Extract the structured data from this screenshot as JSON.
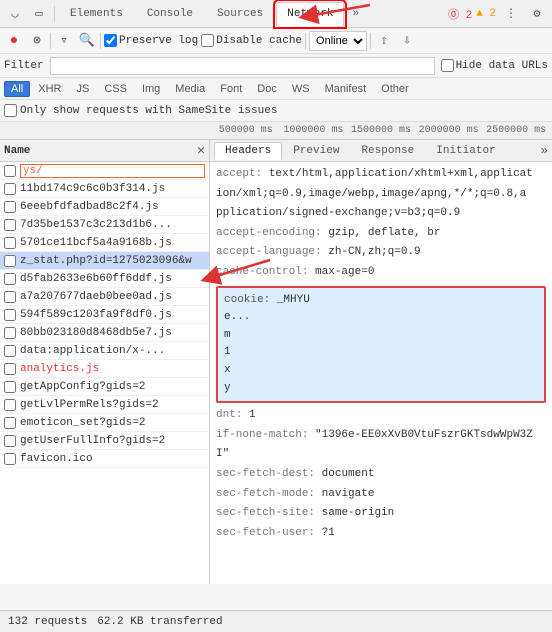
{
  "devtools": {
    "tabs": [
      {
        "label": "Elements",
        "active": false
      },
      {
        "label": "Console",
        "active": false
      },
      {
        "label": "Sources",
        "active": false
      },
      {
        "label": "Network",
        "active": true
      },
      {
        "label": "»",
        "active": false
      }
    ],
    "toolbar_icons": [
      "record",
      "clear",
      "filter",
      "search"
    ],
    "preserve_log": {
      "label": "Preserve log",
      "checked": true
    },
    "disable_cache": {
      "label": "Disable cache",
      "checked": false
    },
    "online_label": "Online",
    "error_badge": "⓪ 2",
    "warning_badge": "▲ 2",
    "more_icon": "⋮",
    "settings_icon": "⚙"
  },
  "filter_bar": {
    "label": "Filter",
    "hide_data_label": "Hide data URLs"
  },
  "type_filters": [
    {
      "label": "All",
      "active": true
    },
    {
      "label": "XHR"
    },
    {
      "label": "JS"
    },
    {
      "label": "CSS"
    },
    {
      "label": "Img"
    },
    {
      "label": "Media"
    },
    {
      "label": "Font"
    },
    {
      "label": "Doc"
    },
    {
      "label": "WS"
    },
    {
      "label": "Manifest"
    },
    {
      "label": "Other"
    }
  ],
  "samesite": {
    "label": "Only show requests with SameSite issues"
  },
  "waterfall": {
    "ticks": [
      "500000 ms",
      "1000000 ms",
      "1500000 ms",
      "2000000 ms",
      "2500000 ms"
    ]
  },
  "left_panel": {
    "column_name": "Name",
    "close_btn": "✕",
    "items": [
      {
        "name": "ys/",
        "selected": false,
        "highlight": true,
        "red": false
      },
      {
        "name": "11bd174c9c6c0b3f314.js",
        "selected": false,
        "highlight": false,
        "red": false
      },
      {
        "name": "6eeebfdfadbad8c2f4.js",
        "selected": false,
        "highlight": false,
        "red": false
      },
      {
        "name": "7d35be1537c3c213d1b6...",
        "selected": false,
        "highlight": false,
        "red": false
      },
      {
        "name": "5701ce11bcf5a4a9168b.js",
        "selected": false,
        "highlight": false,
        "red": false
      },
      {
        "name": "z_stat.php?id=1275023096&w",
        "selected": true,
        "highlight": false,
        "red": false
      },
      {
        "name": "d5fab2633e6b60ff6ddf.js",
        "selected": false,
        "highlight": false,
        "red": false
      },
      {
        "name": "a7a207677daeb0bee0ad.js",
        "selected": false,
        "highlight": false,
        "red": false
      },
      {
        "name": "594f589c1203fa9f8df0.js",
        "selected": false,
        "highlight": false,
        "red": false
      },
      {
        "name": "80bb023180d8468db5e7.js",
        "selected": false,
        "highlight": false,
        "red": false
      },
      {
        "name": "data:application/x-...",
        "selected": false,
        "highlight": false,
        "red": false
      },
      {
        "name": "analytics.js",
        "selected": false,
        "highlight": false,
        "red": true
      },
      {
        "name": "getAppConfig?gids=2",
        "selected": false,
        "highlight": false,
        "red": false
      },
      {
        "name": "getLvlPermRels?gids=2",
        "selected": false,
        "highlight": false,
        "red": false
      },
      {
        "name": "emoticon_set?gids=2",
        "selected": false,
        "highlight": false,
        "red": false
      },
      {
        "name": "getUserFullInfo?gids=2",
        "selected": false,
        "highlight": false,
        "red": false
      },
      {
        "name": "favicon.ico",
        "selected": false,
        "highlight": false,
        "red": false
      }
    ]
  },
  "right_panel": {
    "tabs": [
      {
        "label": "Headers",
        "active": true
      },
      {
        "label": "Preview",
        "active": false
      },
      {
        "label": "Response",
        "active": false
      },
      {
        "label": "Initiator",
        "active": false
      },
      {
        "label": "»",
        "active": false
      }
    ],
    "headers": [
      {
        "key": "accept:",
        "val": "text/html,application/xhtml+xml,applicat"
      },
      {
        "key": "",
        "val": "ion/xml;q=0.9,image/webp,image/apng,*/*;q=0.8,a"
      },
      {
        "key": "",
        "val": "pplication/signed-exchange;v=b3;q=0.9"
      },
      {
        "key": "accept-encoding:",
        "val": "gzip, deflate, br"
      },
      {
        "key": "accept-language:",
        "val": "zh-CN,zh;q=0.9"
      },
      {
        "key": "cache-control:",
        "val": "max-age=0"
      }
    ],
    "cookie": {
      "key": "cookie:",
      "val": "_MHYU",
      "extra_lines": [
        "e...",
        "m",
        "1",
        "x",
        "y"
      ]
    },
    "headers_after": [
      {
        "key": "dnt:",
        "val": "1"
      },
      {
        "key": "if-none-match:",
        "val": "\"1396e-EE0xXvB0VtuFszrGKTsdwWpW3Z"
      },
      {
        "key": "",
        "val": "I\""
      },
      {
        "key": "sec-fetch-dest:",
        "val": "document"
      },
      {
        "key": "sec-fetch-mode:",
        "val": "navigate"
      },
      {
        "key": "sec-fetch-site:",
        "val": "same-origin"
      },
      {
        "key": "sec-fetch-user:",
        "val": "?1"
      }
    ]
  },
  "status_bar": {
    "requests": "132 requests",
    "transferred": "62.2 KB transferred"
  }
}
